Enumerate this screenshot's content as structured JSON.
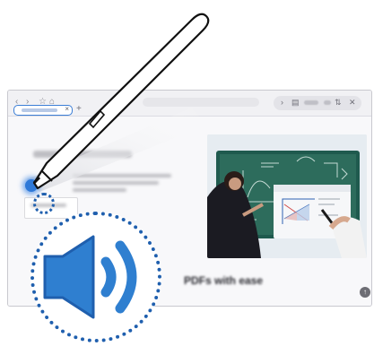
{
  "page_heading": "PDFs with ease",
  "browser": {
    "toolbar": {
      "back_icon": "chevron-left-icon",
      "forward_icon": "chevron-right-icon",
      "bookmark_icon": "star-icon",
      "home_icon": "home-icon",
      "right_icons": [
        "chevron-right-icon",
        "reader-mode-icon",
        "refresh-icon",
        "close-icon"
      ]
    },
    "new_tab_icon": "plus-icon",
    "scroll_top_icon": "arrow-up-icon"
  },
  "badge": {
    "icon": "speaker-volume-icon",
    "accent_color": "#1f5fae",
    "fill_color": "#2f7fd0"
  },
  "glyphs": {
    "back": "‹",
    "forward": "›",
    "bookmark": "☆",
    "home": "⌂",
    "pill_next": "›",
    "pill_reader": "▤",
    "pill_refresh": "⇅",
    "pill_close": "✕",
    "tab_close": "×",
    "new_tab": "+",
    "scroll_top": "↑"
  }
}
